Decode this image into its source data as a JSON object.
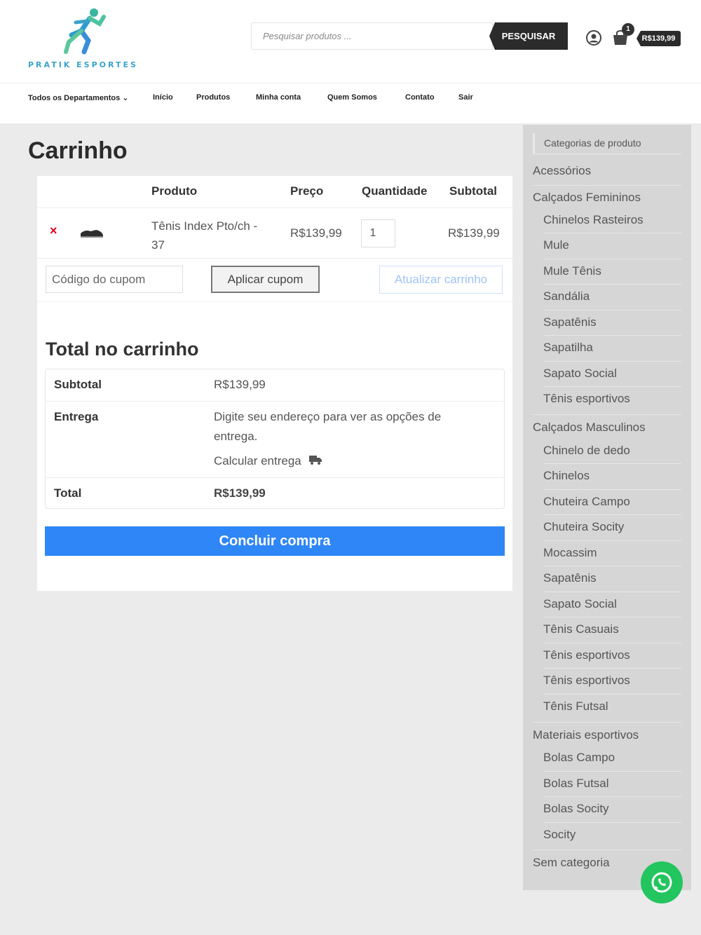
{
  "brand": {
    "name": "PRATIK ESPORTES",
    "accent": "#2f86f6"
  },
  "search": {
    "placeholder": "Pesquisar produtos ...",
    "button_label": "PESQUISAR"
  },
  "header": {
    "cart_count": "1",
    "cart_total": "R$139,99"
  },
  "nav": {
    "items": [
      "Todos os Departamentos",
      "Início",
      "Produtos",
      "Minha conta",
      "Quem Somos",
      "Contato",
      "Sair"
    ]
  },
  "page": {
    "title": "Carrinho"
  },
  "cart": {
    "headers": {
      "product": "Produto",
      "price": "Preço",
      "quantity": "Quantidade",
      "subtotal": "Subtotal"
    },
    "items": [
      {
        "remove": "×",
        "name": "Tênis Index Pto/ch - 37",
        "price": "R$139,99",
        "quantity": "1",
        "subtotal": "R$139,99"
      }
    ],
    "coupon_placeholder": "Código do cupom",
    "apply_coupon_label": "Aplicar cupom",
    "update_cart_label": "Atualizar carrinho"
  },
  "totals": {
    "title": "Total no carrinho",
    "subtotal_label": "Subtotal",
    "subtotal_value": "R$139,99",
    "shipping_label": "Entrega",
    "shipping_text": "Digite seu endereço para ver as opções de entrega.",
    "calc_shipping_label": "Calcular entrega",
    "total_label": "Total",
    "total_value": "R$139,99",
    "checkout_label": "Concluir compra"
  },
  "sidebar": {
    "title": "Categorias de produto",
    "categories": [
      {
        "label": "Acessórios"
      },
      {
        "label": "Calçados Femininos",
        "children": [
          "Chinelos Rasteiros",
          "Mule",
          "Mule Tênis",
          "Sandália",
          "Sapatênis",
          "Sapatilha",
          "Sapato Social",
          "Tênis esportivos"
        ]
      },
      {
        "label": "Calçados Masculinos",
        "children": [
          "Chinelo de dedo",
          "Chinelos",
          "Chuteira Campo",
          "Chuteira Socity",
          "Mocassim",
          "Sapatênis",
          "Sapato Social",
          "Tênis Casuais",
          "Tênis esportivos",
          "Tênis esportivos",
          "Tênis Futsal"
        ]
      },
      {
        "label": "Materiais esportivos",
        "children": [
          "Bolas Campo",
          "Bolas Futsal",
          "Bolas Socity",
          "Socity"
        ]
      },
      {
        "label": "Sem categoria"
      }
    ]
  },
  "icons": {
    "account": "user-circle-icon",
    "cart": "shopping-bag-icon",
    "whatsapp": "whatsapp-icon",
    "truck": "truck-icon",
    "remove": "close-icon"
  }
}
